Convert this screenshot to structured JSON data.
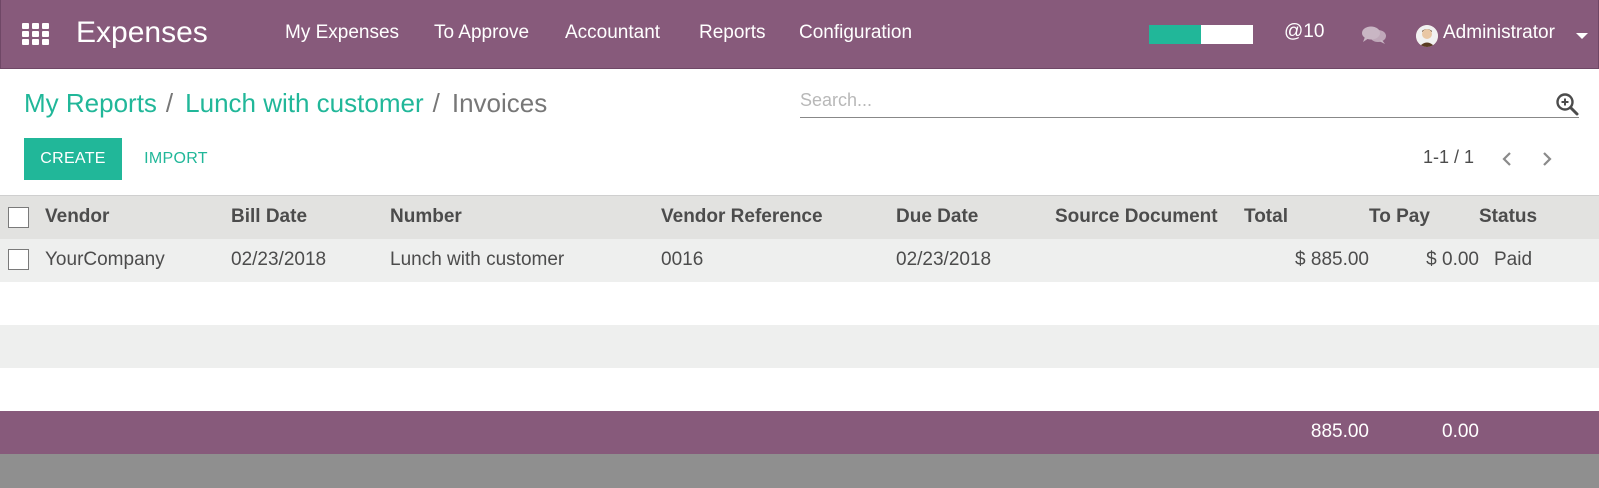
{
  "navbar": {
    "app_title": "Expenses",
    "menu": [
      "My Expenses",
      "To Approve",
      "Accountant",
      "Reports",
      "Configuration"
    ],
    "progress_fraction": 0.5,
    "mentions": "@10",
    "user": "Administrator",
    "colors": {
      "bar": "#875a7b",
      "accent": "#21b799"
    },
    "icons": [
      "apps-grid-icon",
      "chat-bubbles-icon",
      "user-avatar-icon",
      "caret-down-icon"
    ]
  },
  "breadcrumb": {
    "items": [
      "My Reports",
      "Lunch with customer"
    ],
    "separator": "/",
    "current": "Invoices"
  },
  "search": {
    "placeholder": "Search..."
  },
  "buttons": {
    "create": "CREATE",
    "import": "IMPORT"
  },
  "pager": {
    "value": "1-1 / 1"
  },
  "table": {
    "columns": [
      "Vendor",
      "Bill Date",
      "Number",
      "Vendor Reference",
      "Due Date",
      "Source Document",
      "Total",
      "To Pay",
      "Status"
    ],
    "rows": [
      {
        "vendor": "YourCompany",
        "bill_date": "02/23/2018",
        "number": "Lunch with customer",
        "vendor_reference": "0016",
        "due_date": "02/23/2018",
        "source_document": "",
        "total": "$ 885.00",
        "to_pay": "$ 0.00",
        "status": "Paid"
      }
    ],
    "footer": {
      "total": "885.00",
      "to_pay": "0.00"
    }
  }
}
